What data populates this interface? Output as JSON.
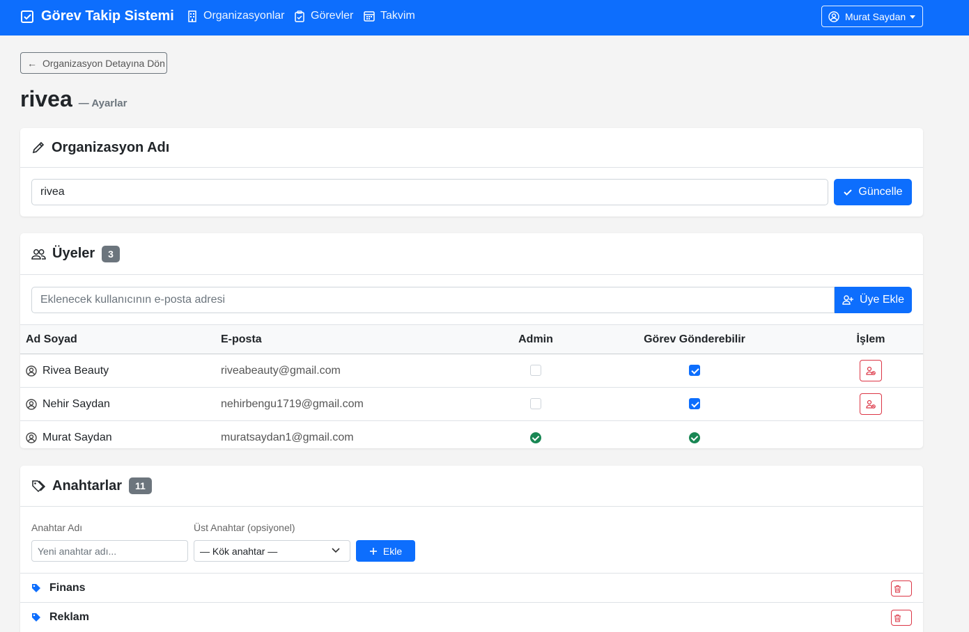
{
  "navbar": {
    "brand": "Görev Takip Sistemi",
    "links": [
      "Organizasyonlar",
      "Görevler",
      "Takvim"
    ],
    "user": "Murat Saydan",
    "bg_color": "#0d6efd"
  },
  "back_button": "Organizasyon Detayına Dön",
  "page": {
    "title": "rivea",
    "subtitle": "— Ayarlar"
  },
  "org_name_card": {
    "title": "Organizasyon Adı",
    "input_value": "rivea",
    "submit_label": "Güncelle"
  },
  "members_card": {
    "title": "Üyeler",
    "count": "3",
    "input_placeholder": "Eklenecek kullanıcının e-posta adresi",
    "add_label": "Üye Ekle",
    "columns": [
      "Ad Soyad",
      "E-posta",
      "Admin",
      "Görev Gönderebilir",
      "İşlem"
    ],
    "rows": [
      {
        "name": "Rivea Beauty",
        "email": "riveabeauty@gmail.com",
        "admin": "unchecked",
        "can_send": "checked",
        "action": "remove-user"
      },
      {
        "name": "Nehir Saydan",
        "email": "nehirbengu1719@gmail.com",
        "admin": "unchecked",
        "can_send": "checked",
        "action": "remove-user"
      },
      {
        "name": "Murat Saydan",
        "email": "muratsaydan1@gmail.com",
        "admin": "confirmed",
        "can_send": "confirmed",
        "action": ""
      }
    ]
  },
  "tags_card": {
    "title": "Anahtarlar",
    "count": "11",
    "name_label": "Anahtar Adı",
    "name_placeholder": "Yeni anahtar adı...",
    "parent_label": "Üst Anahtar (opsiyonel)",
    "parent_selected": "— Kök anahtar —",
    "add_label": "Ekle",
    "items": [
      "Finans",
      "Reklam"
    ]
  }
}
